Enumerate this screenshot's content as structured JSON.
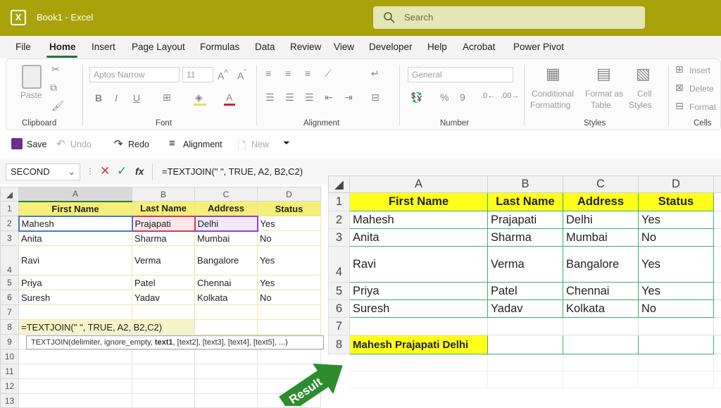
{
  "title_bar": {
    "app_icon": "excel-icon",
    "title": "Book1  -  Excel",
    "search_placeholder": "Search"
  },
  "menu": [
    "File",
    "Home",
    "Insert",
    "Page Layout",
    "Formulas",
    "Data",
    "Review",
    "View",
    "Developer",
    "Help",
    "Acrobat",
    "Power Pivot"
  ],
  "active_menu": "Home",
  "ribbon": {
    "clipboard": {
      "paste": "Paste",
      "label": "Clipboard"
    },
    "font": {
      "name": "Aptos Narrow",
      "size": "11",
      "label": "Font"
    },
    "alignment": {
      "label": "Alignment"
    },
    "number": {
      "format": "General",
      "label": "Number"
    },
    "styles": {
      "conditional": "Conditional",
      "formatting": "Formatting",
      "format_as": "Format as",
      "table": "Table",
      "cell": "Cell",
      "styles_word": "Styles",
      "label": "Styles"
    },
    "cells": {
      "insert": "Insert",
      "delete": "Delete",
      "format": "Format",
      "label": "Cells"
    }
  },
  "quick_access": {
    "save": "Save",
    "undo": "Undo",
    "redo": "Redo",
    "alignment": "Alignment",
    "new": "New"
  },
  "formula_bar": {
    "name_box": "SECOND",
    "fx": "fx",
    "formula": "=TEXTJOIN(\" \", TRUE, A2, B2,C2)"
  },
  "left_sheet": {
    "columns": [
      "A",
      "B",
      "C",
      "D"
    ],
    "rows": [
      [
        "First Name",
        "Last Name",
        "Address",
        "Status"
      ],
      [
        "Mahesh",
        "Prajapati",
        "Delhi",
        "Yes"
      ],
      [
        "Anita",
        "Sharma",
        "Mumbai",
        "No"
      ],
      [
        "Ravi",
        "Verma",
        "Bangalore",
        "Yes"
      ],
      [
        "Priya",
        "Patel",
        "Chennai",
        "Yes"
      ],
      [
        "Suresh",
        "Yadav",
        "Kolkata",
        "No"
      ],
      [
        "",
        "",
        "",
        ""
      ],
      [
        "=TEXTJOIN(\" \", TRUE, A2, B2,C2)",
        "",
        "",
        ""
      ],
      [
        "",
        "",
        "",
        ""
      ],
      [
        "",
        "",
        "",
        ""
      ],
      [
        "",
        "",
        "",
        ""
      ],
      [
        "",
        "",
        "",
        ""
      ],
      [
        "",
        "",
        "",
        ""
      ]
    ],
    "row_numbers": [
      "1",
      "2",
      "3",
      "4",
      "5",
      "6",
      "7",
      "8",
      "9",
      "10",
      "11",
      "12",
      "13"
    ],
    "tooltip": "TEXTJOIN(delimiter, ignore_empty, text1, [text2], [text3], [text4], [text5], ...)",
    "tooltip_pre": "TEXTJOIN(delimiter, ignore_empty, ",
    "tooltip_bold": "text1",
    "tooltip_post": ", [text2], [text3], [text4], [text5], ...)"
  },
  "right_sheet": {
    "columns": [
      "A",
      "B",
      "C",
      "D"
    ],
    "rows": [
      [
        "First Name",
        "Last Name",
        "Address",
        "Status"
      ],
      [
        "Mahesh",
        "Prajapati",
        "Delhi",
        "Yes"
      ],
      [
        "Anita",
        "Sharma",
        "Mumbai",
        "No"
      ],
      [
        "Ravi",
        "Verma",
        "Bangalore",
        "Yes"
      ],
      [
        "Priya",
        "Patel",
        "Chennai",
        "Yes"
      ],
      [
        "Suresh",
        "Yadav",
        "Kolkata",
        "No"
      ],
      [
        "",
        "",
        "",
        ""
      ],
      [
        "Mahesh Prajapati Delhi",
        "",
        "",
        ""
      ]
    ],
    "row_numbers": [
      "1",
      "2",
      "3",
      "4",
      "5",
      "6",
      "7",
      "8"
    ]
  },
  "result_label": "Result",
  "colors": {
    "title_bar": "#a8a30b",
    "header_fill": "#ffff1a",
    "green_border": "#38b26a",
    "arrow": "#2e8b2e"
  }
}
